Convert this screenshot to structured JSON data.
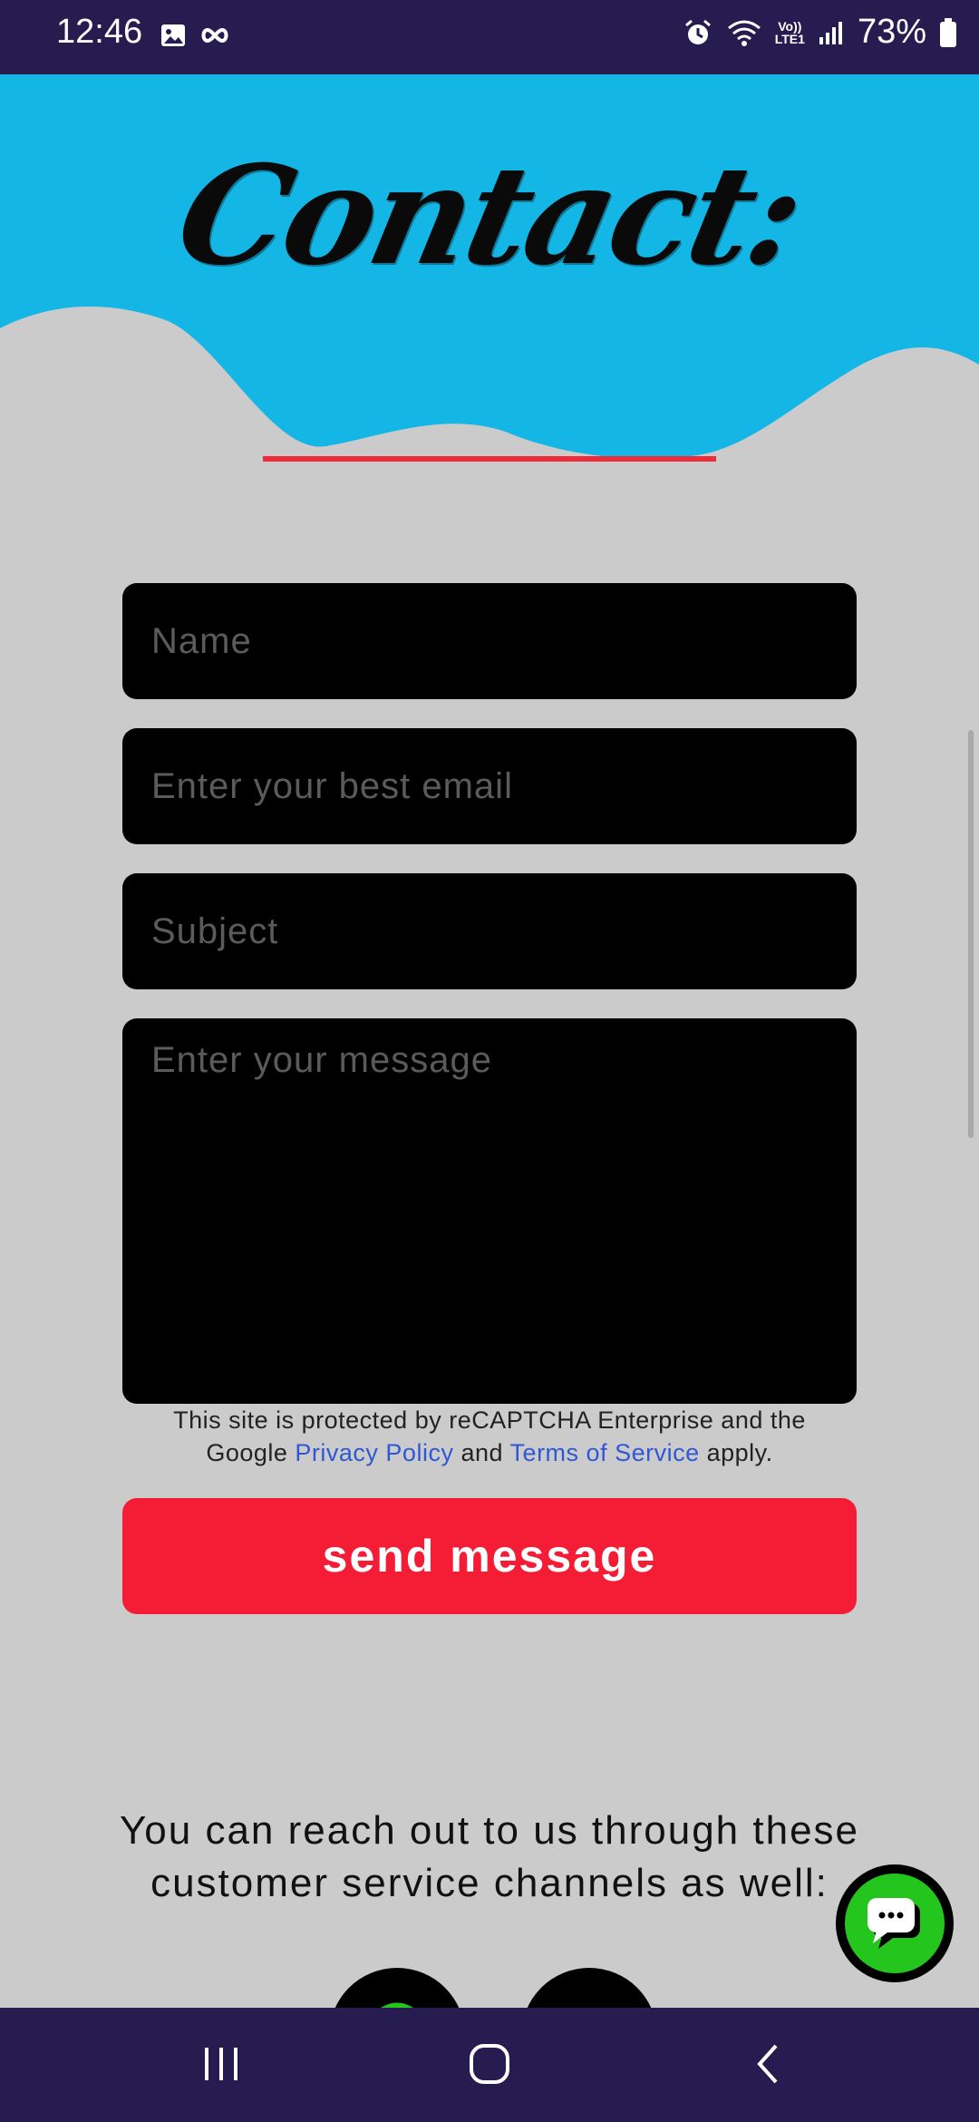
{
  "status_bar": {
    "time": "12:46",
    "battery": "73%",
    "network_label_top": "Vo))",
    "network_label_bottom": "LTE1"
  },
  "hero": {
    "title": "Contact:",
    "sky_color": "#14b6e6",
    "underline_color": "#ee2b3b"
  },
  "form": {
    "name_placeholder": "Name",
    "email_placeholder": "Enter your best email",
    "subject_placeholder": "Subject",
    "message_placeholder": "Enter your message",
    "recaptcha": {
      "line1": "This site is protected by reCAPTCHA Enterprise and the",
      "prefix": "Google",
      "privacy_link": "Privacy Policy",
      "and": "and",
      "terms_link": "Terms of Service",
      "suffix": "apply."
    },
    "send_label": "send message"
  },
  "reach": {
    "line1": "You can reach out to us through these",
    "line2": "customer service channels as well:"
  },
  "icons": {
    "chat": "chat-bubble-icon",
    "gallery": "image-icon",
    "alarm": "alarm-icon",
    "wifi": "wifi-icon",
    "signal": "signal-icon",
    "battery": "battery-icon"
  },
  "colors": {
    "accent": "#f51d36",
    "status_bg": "#271c4f",
    "page_bg": "#cbcbcb",
    "chat_green": "#24c51c"
  }
}
